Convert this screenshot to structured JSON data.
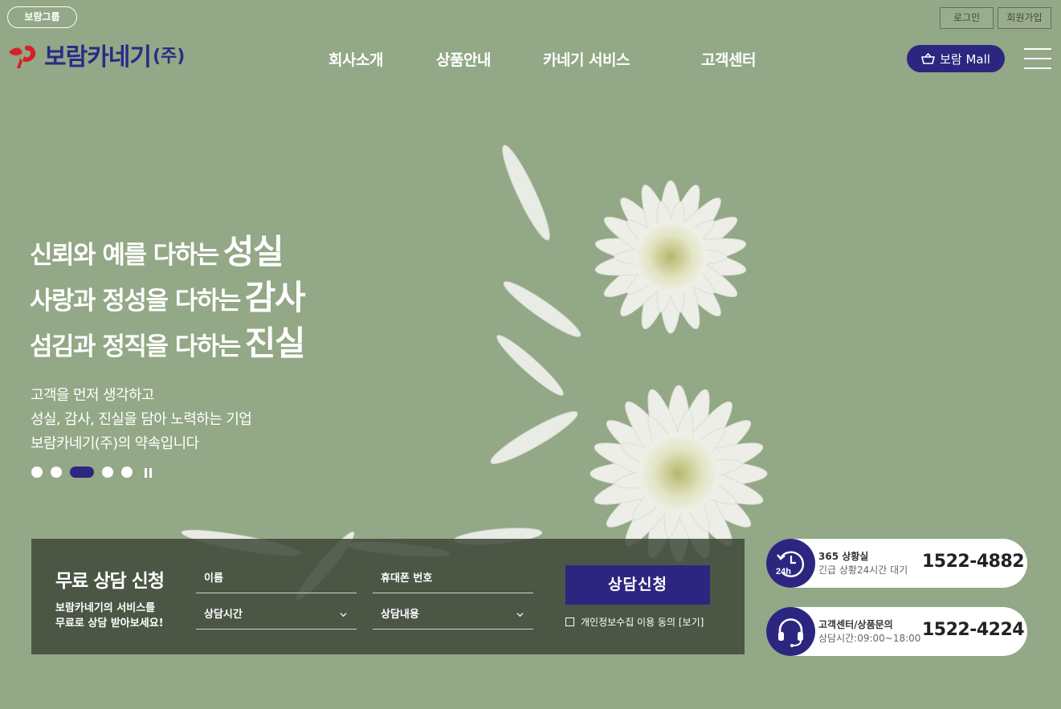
{
  "header": {
    "group_label": "보람그룹",
    "login_label": "로그인",
    "join_label": "회원가입",
    "logo_text": "보람카네기",
    "logo_suffix": "(주)",
    "nav": [
      "회사소개",
      "상품안내",
      "카네기 서비스",
      "고객센터"
    ],
    "mall_label": "보람 Mall"
  },
  "hero": {
    "lines": [
      {
        "text": "신뢰와 예를 다하는",
        "emphasis": "성실"
      },
      {
        "text": "사랑과 정성을 다하는",
        "emphasis": "감사"
      },
      {
        "text": "섬김과 정직을 다하는",
        "emphasis": "진실"
      }
    ],
    "subtext": [
      "고객을 먼저 생각하고",
      "성실, 감사, 진실을 담아 노력하는 기업",
      "보람카네기(주)의 약속입니다"
    ],
    "slider": {
      "count": 5,
      "active_index": 3
    }
  },
  "consult": {
    "title": "무료 상담 신청",
    "desc_line1": "보람카네기의 서비스를",
    "desc_line2": "무료로 상담 받아보세요!",
    "name_placeholder": "이름",
    "phone_placeholder": "휴대폰 번호",
    "time_select": "상담시간",
    "content_select": "상담내용",
    "submit_label": "상담신청",
    "agree_label": "개인정보수집 이용 동의 [보기]"
  },
  "contacts": [
    {
      "icon": "24h-clock-icon",
      "label": "365 상황실",
      "desc": "긴급 상황24시간 대기",
      "number": "1522-4882"
    },
    {
      "icon": "headset-icon",
      "label": "고객센터/상품문의",
      "desc": "상담시간:09:00~18:00",
      "number": "1522-4224"
    }
  ],
  "colors": {
    "background": "#93a886",
    "brand": "#2d2680",
    "logo_red": "#d6202a"
  }
}
